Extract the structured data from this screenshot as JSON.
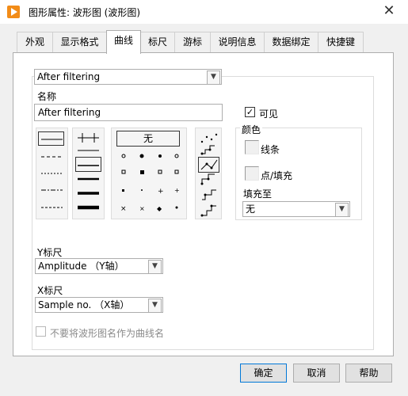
{
  "window": {
    "title": "图形属性: 波形图 (波形图)"
  },
  "tabs": [
    {
      "label": "外观"
    },
    {
      "label": "显示格式"
    },
    {
      "label": "曲线"
    },
    {
      "label": "标尺"
    },
    {
      "label": "游标"
    },
    {
      "label": "说明信息"
    },
    {
      "label": "数据绑定"
    },
    {
      "label": "快捷键"
    }
  ],
  "active_tab": "曲线",
  "plot_select": {
    "value": "After filtering"
  },
  "name_field": {
    "label": "名称",
    "value": "After filtering"
  },
  "visible": {
    "label": "可见",
    "checked": true
  },
  "point_style": {
    "none_label": "无"
  },
  "color_group": {
    "label": "颜色",
    "line_label": "线条",
    "fill_label": "点/填充",
    "fill_to_label": "填充至",
    "fill_to_value": "无"
  },
  "y_scale": {
    "label": "Y标尺",
    "value": "Amplitude （Y轴）"
  },
  "x_scale": {
    "label": "X标尺",
    "value": "Sample no. （X轴）"
  },
  "no_waveform_name": {
    "label": "不要将波形图名作为曲线名",
    "checked": false,
    "enabled": false
  },
  "buttons": {
    "ok": "确定",
    "cancel": "取消",
    "help": "帮助"
  }
}
